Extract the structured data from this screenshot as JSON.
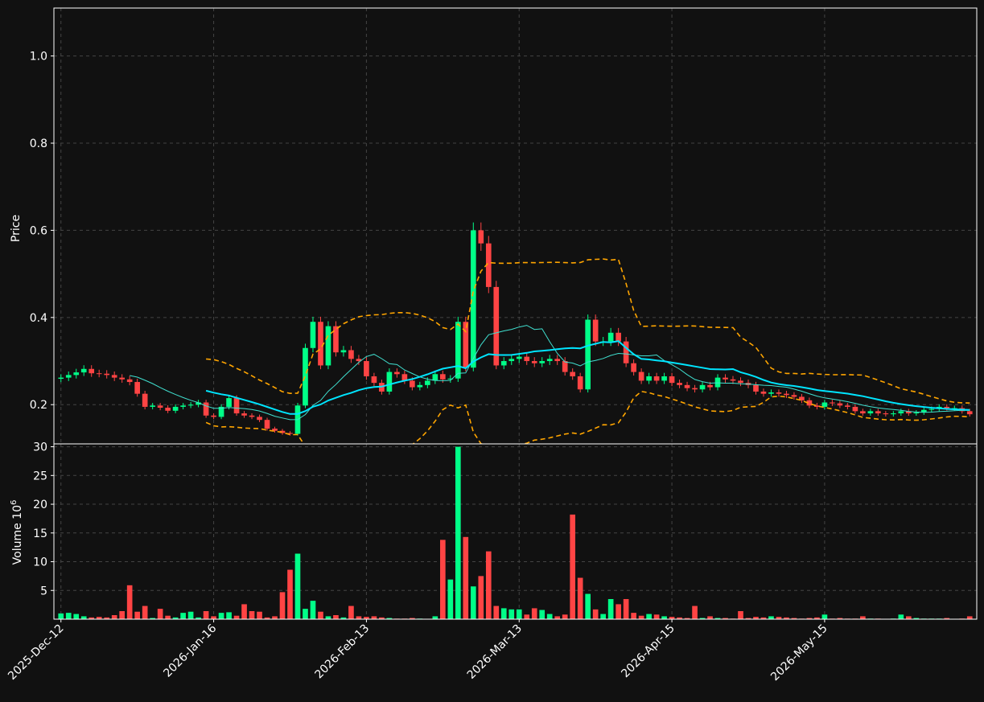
{
  "colors": {
    "background": "#111111",
    "up": "#00ff88",
    "down": "#ff4444",
    "ma_short": "#40e0d0",
    "ma_long": "#00e5ff",
    "bollinger": "#ffa500",
    "grid": "#444444",
    "axis": "#ffffff"
  },
  "chart_data": {
    "type": "candlestick",
    "price_panel": {
      "ylabel": "Price",
      "ylim": [
        0.11,
        1.11
      ],
      "yticks": [
        "0.2",
        "0.4",
        "0.6",
        "0.8",
        "1.0"
      ],
      "ytick_values": [
        0.2,
        0.4,
        0.6,
        0.8,
        1.0
      ],
      "grid": true
    },
    "volume_panel": {
      "ylabel": "Volume",
      "ylabel_exponent": "10",
      "ylabel_exponent_power": "6",
      "ylim": [
        0,
        30.5
      ],
      "yticks": [
        "5",
        "10",
        "15",
        "20",
        "25",
        "30"
      ],
      "ytick_values": [
        5,
        10,
        15,
        20,
        25,
        30
      ],
      "grid": true
    },
    "xticks": [
      {
        "label": "2025-Dec-12",
        "index": 0
      },
      {
        "label": "2026-Jan-16",
        "index": 20
      },
      {
        "label": "2026-Feb-13",
        "index": 40
      },
      {
        "label": "2026-Mar-13",
        "index": 60
      },
      {
        "label": "2026-Apr-15",
        "index": 80
      },
      {
        "label": "2026-May-15",
        "index": 100
      }
    ],
    "total_bars": 120,
    "closes": [
      0.262,
      0.268,
      0.274,
      0.282,
      0.272,
      0.271,
      0.268,
      0.262,
      0.258,
      0.252,
      0.225,
      0.195,
      0.198,
      0.193,
      0.186,
      0.195,
      0.198,
      0.2,
      0.205,
      0.175,
      0.172,
      0.195,
      0.215,
      0.18,
      0.175,
      0.172,
      0.165,
      0.145,
      0.14,
      0.135,
      0.133,
      0.198,
      0.33,
      0.39,
      0.29,
      0.38,
      0.32,
      0.325,
      0.305,
      0.3,
      0.265,
      0.25,
      0.23,
      0.275,
      0.27,
      0.255,
      0.24,
      0.245,
      0.255,
      0.27,
      0.258,
      0.26,
      0.39,
      0.285,
      0.6,
      0.57,
      0.47,
      0.29,
      0.3,
      0.305,
      0.31,
      0.3,
      0.295,
      0.3,
      0.305,
      0.3,
      0.275,
      0.265,
      0.235,
      0.395,
      0.345,
      0.345,
      0.365,
      0.345,
      0.295,
      0.275,
      0.255,
      0.265,
      0.255,
      0.265,
      0.25,
      0.245,
      0.238,
      0.235,
      0.245,
      0.24,
      0.262,
      0.258,
      0.255,
      0.25,
      0.245,
      0.23,
      0.225,
      0.228,
      0.225,
      0.222,
      0.218,
      0.21,
      0.198,
      0.195,
      0.205,
      0.203,
      0.198,
      0.195,
      0.185,
      0.18,
      0.185,
      0.18,
      0.178,
      0.18,
      0.185,
      0.18,
      0.182,
      0.188,
      0.19,
      0.195,
      0.192,
      0.192,
      0.185,
      0.178
    ],
    "volumes": [
      1.0,
      1.1,
      0.9,
      0.5,
      0.3,
      0.4,
      0.3,
      0.7,
      1.4,
      5.9,
      1.3,
      2.3,
      0.2,
      1.8,
      0.6,
      0.3,
      1.1,
      1.3,
      0.3,
      1.4,
      0.5,
      1.1,
      1.2,
      0.6,
      2.6,
      1.4,
      1.3,
      0.3,
      0.5,
      4.7,
      8.6,
      11.4,
      1.8,
      3.2,
      1.3,
      0.5,
      0.7,
      0.3,
      2.3,
      0.5,
      0.4,
      0.5,
      0.3,
      0.2,
      0.1,
      0.1,
      0.2,
      0.1,
      0.0,
      0.5,
      13.8,
      6.9,
      30.0,
      14.3,
      5.7,
      7.5,
      11.8,
      2.3,
      1.9,
      1.7,
      1.7,
      0.8,
      1.9,
      1.6,
      0.9,
      0.5,
      0.8,
      18.2,
      7.2,
      4.4,
      1.7,
      0.9,
      3.5,
      2.6,
      3.5,
      1.1,
      0.6,
      0.9,
      0.8,
      0.5,
      0.4,
      0.3,
      0.2,
      2.3,
      0.2,
      0.5,
      0.2,
      0.2,
      0.1,
      1.4,
      0.2,
      0.4,
      0.3,
      0.5,
      0.4,
      0.3,
      0.2,
      0.1,
      0.2,
      0.3,
      0.8,
      0.1,
      0.2,
      0.1,
      0.1,
      0.5,
      0.1,
      0.1,
      0.0,
      0.1,
      0.8,
      0.5,
      0.2,
      0.1,
      0.1,
      0.1,
      0.2,
      0.0,
      0.1,
      0.5
    ],
    "series": [
      {
        "kind": "candles"
      },
      {
        "kind": "moving_average_short",
        "window": 10
      },
      {
        "kind": "moving_average_long",
        "window": 20
      },
      {
        "kind": "bollinger_bands",
        "window": 20,
        "k": 2
      }
    ]
  }
}
